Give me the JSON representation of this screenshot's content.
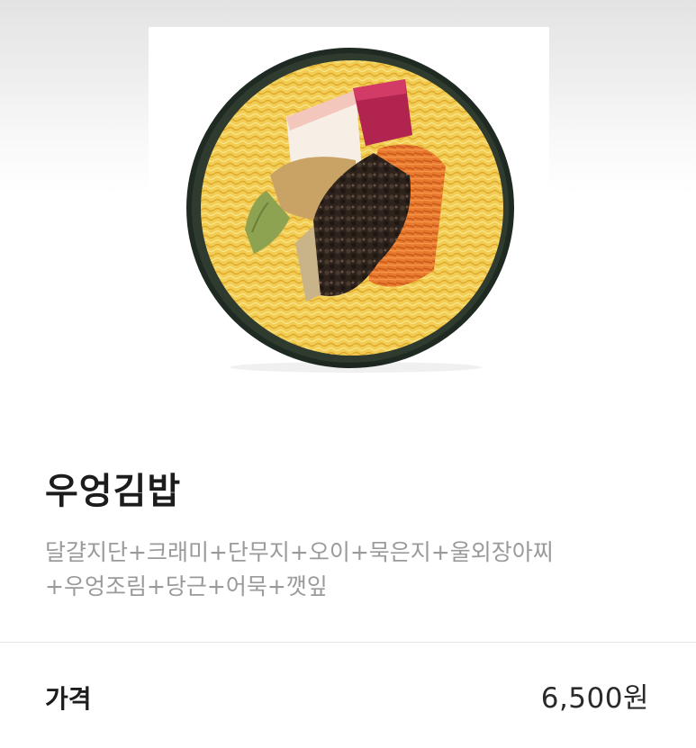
{
  "product": {
    "image_alt": "우엉김밥 단면 사진",
    "name": "우엉김밥",
    "description_line1": "달걀지단+크래미+단무지+오이+묵은지+울외장아찌",
    "description_line2": "+우엉조림+당근+어묵+깻잎"
  },
  "price": {
    "label": "가격",
    "value": "6,500원"
  }
}
